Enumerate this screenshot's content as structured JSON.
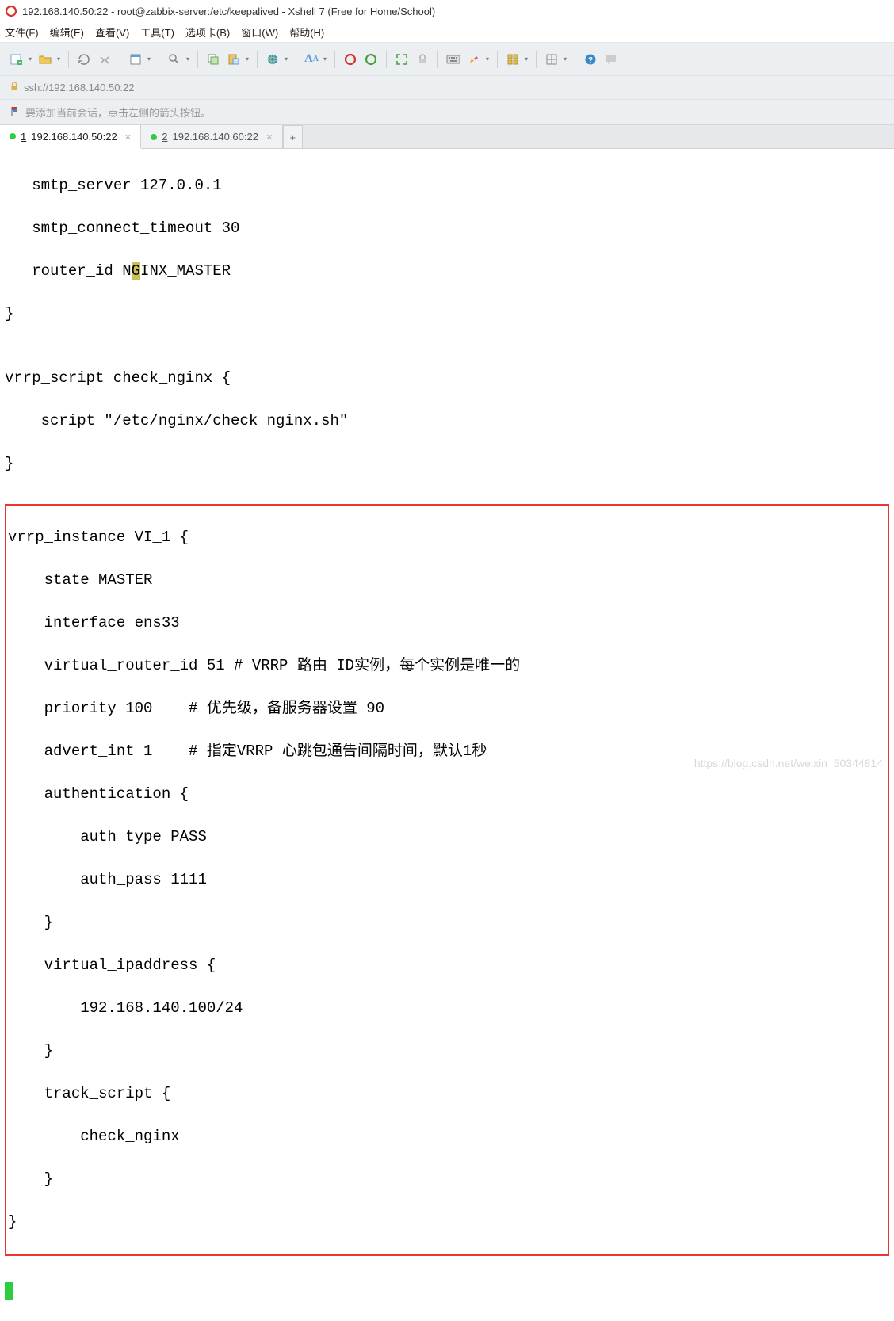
{
  "title": "192.168.140.50:22 - root@zabbix-server:/etc/keepalived - Xshell 7 (Free for Home/School)",
  "menu": {
    "file": "文件(F)",
    "edit": "编辑(E)",
    "view": "查看(V)",
    "tools": "工具(T)",
    "tabs": "选项卡(B)",
    "window": "窗口(W)",
    "help": "帮助(H)"
  },
  "address": "ssh://192.168.140.50:22",
  "hint": "要添加当前会话，点击左侧的箭头按钮。",
  "tabs": [
    {
      "num": "1",
      "label": "192.168.140.50:22",
      "active": true
    },
    {
      "num": "2",
      "label": "192.168.140.60:22",
      "active": false
    }
  ],
  "term": {
    "l1": "   smtp_server 127.0.0.1",
    "l2": "   smtp_connect_timeout 30",
    "l3a": "   router_id N",
    "l3hl": "G",
    "l3b": "INX_MASTER",
    "l4": "}",
    "l5": "",
    "l6": "vrrp_script check_nginx {",
    "l7": "    script \"/etc/nginx/check_nginx.sh\"",
    "l8": "}",
    "b1": "vrrp_instance VI_1 {",
    "b2": "    state MASTER",
    "b3": "    interface ens33",
    "b4": "    virtual_router_id 51 # VRRP 路由 ID实例，每个实例是唯一的",
    "b5": "    priority 100    # 优先级，备服务器设置 90",
    "b6": "    advert_int 1    # 指定VRRP 心跳包通告间隔时间，默认1秒",
    "b7": "    authentication {",
    "b8": "        auth_type PASS",
    "b9": "        auth_pass 1111",
    "b10": "    }",
    "b11": "    virtual_ipaddress {",
    "b12": "        192.168.140.100/24",
    "b13": "    }",
    "b14": "    track_script {",
    "b15": "        check_nginx",
    "b16": "    }",
    "b17": "}"
  },
  "watermark": "https://blog.csdn.net/weixin_50344814"
}
